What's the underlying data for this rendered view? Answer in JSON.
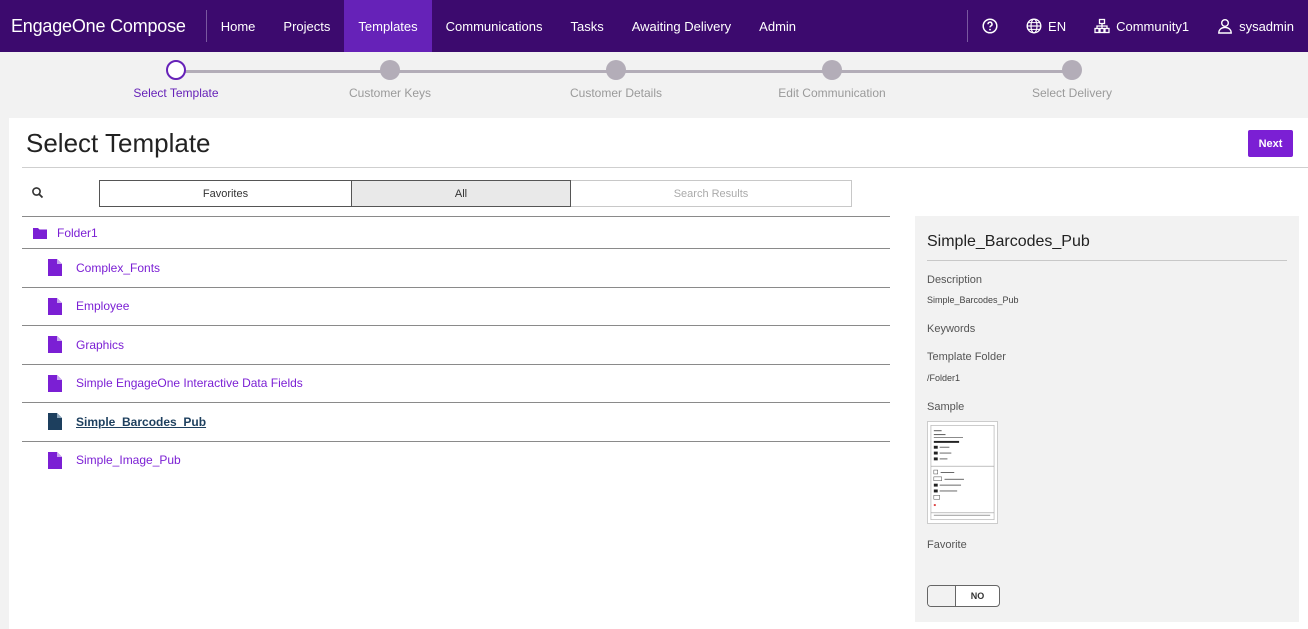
{
  "app": {
    "title": "EngageOne Compose"
  },
  "nav": {
    "items": [
      {
        "label": "Home"
      },
      {
        "label": "Projects"
      },
      {
        "label": "Templates"
      },
      {
        "label": "Communications"
      },
      {
        "label": "Tasks"
      },
      {
        "label": "Awaiting Delivery"
      },
      {
        "label": "Admin"
      }
    ],
    "active": "Templates",
    "language": "EN",
    "community": "Community1",
    "user": "sysadmin"
  },
  "stepper": {
    "steps": [
      {
        "label": "Select Template"
      },
      {
        "label": "Customer Keys"
      },
      {
        "label": "Customer Details"
      },
      {
        "label": "Edit Communication"
      },
      {
        "label": "Select Delivery"
      }
    ],
    "current_index": 0
  },
  "page": {
    "title": "Select Template",
    "next_label": "Next"
  },
  "tabs": {
    "favorites": "Favorites",
    "all": "All",
    "search_results": "Search Results"
  },
  "tree": {
    "folder": "Folder1",
    "items": [
      {
        "label": "Complex_Fonts"
      },
      {
        "label": "Employee"
      },
      {
        "label": "Graphics"
      },
      {
        "label": "Simple EngageOne Interactive Data Fields"
      },
      {
        "label": "Simple_Barcodes_Pub"
      },
      {
        "label": "Simple_Image_Pub"
      }
    ],
    "selected": "Simple_Barcodes_Pub"
  },
  "detail": {
    "title": "Simple_Barcodes_Pub",
    "description_label": "Description",
    "description_value": "Simple_Barcodes_Pub",
    "keywords_label": "Keywords",
    "folder_label": "Template Folder",
    "folder_value": "/Folder1",
    "sample_label": "Sample",
    "favorite_label": "Favorite",
    "favorite_toggle": "NO"
  },
  "colors": {
    "nav_bg": "#3c0a6e",
    "nav_active": "#6622b8",
    "accent": "#7b1fd4",
    "selected_text": "#1d3f5e"
  }
}
